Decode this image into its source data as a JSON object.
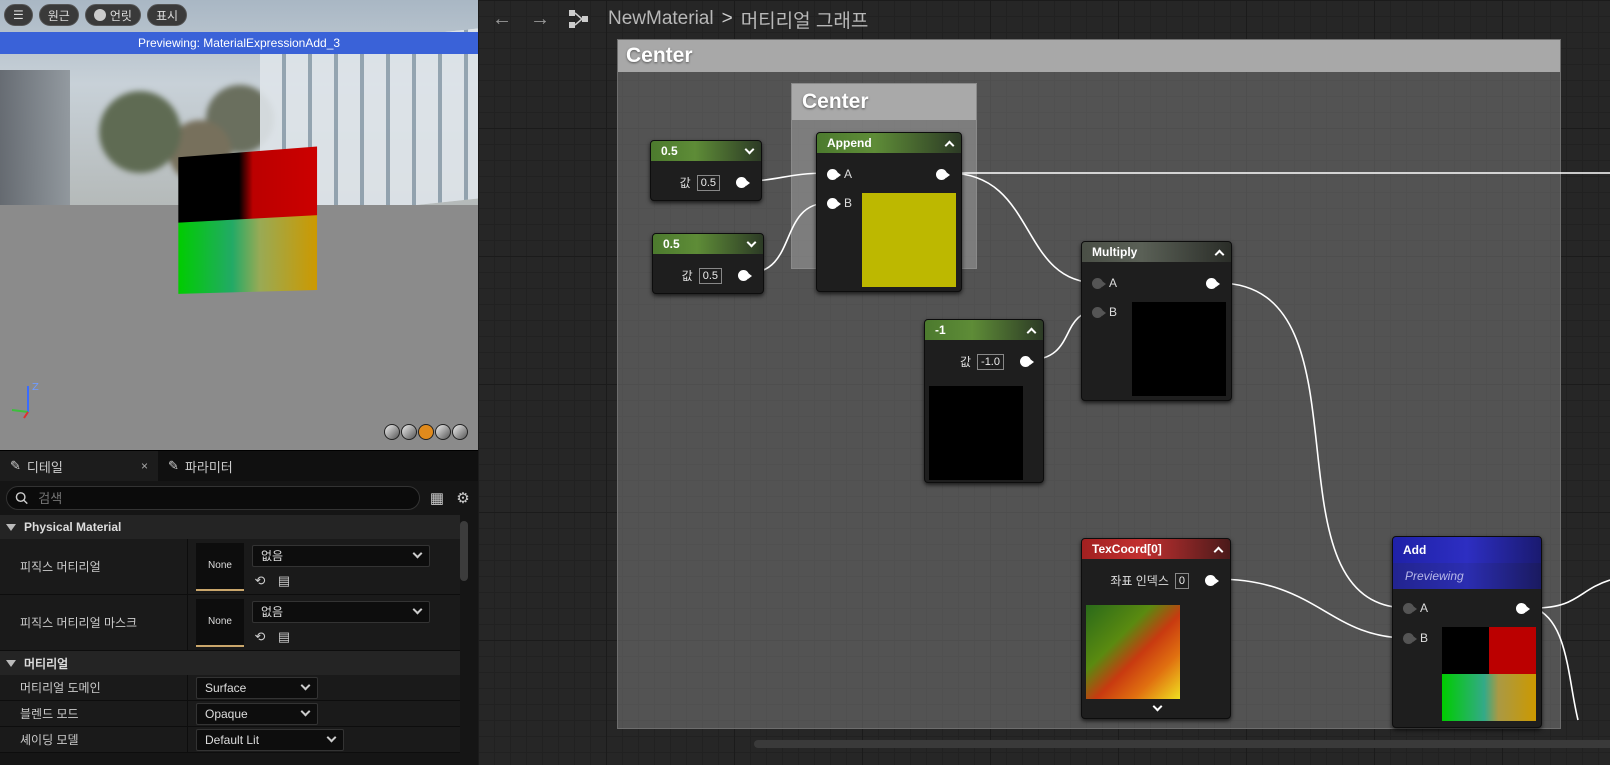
{
  "viewport": {
    "toolbar": {
      "menu_icon": "hamburger-icon",
      "perspective_label": "원근",
      "lit_label": "언릿",
      "show_label": "표시"
    },
    "preview_text": "Previewing: MaterialExpressionAdd_3",
    "axes": {
      "z_label": "Z"
    },
    "preview_shapes": [
      "cylinder",
      "sphere",
      "plane",
      "cube",
      "teapot"
    ],
    "active_shape_color": "#e08a1c"
  },
  "details": {
    "tabs": [
      {
        "label": "디테일",
        "icon": "pencil-icon",
        "active": true
      },
      {
        "label": "파라미터",
        "icon": "pencil-icon",
        "active": false
      }
    ],
    "tab_close": "×",
    "search": {
      "placeholder": "검색",
      "value": ""
    },
    "categories": [
      {
        "title": "Physical Material",
        "rows": [
          {
            "name": "피직스 머티리얼",
            "thumb": "None",
            "combo": "없음"
          },
          {
            "name": "피직스 머티리얼 마스크",
            "thumb": "None",
            "combo": "없음"
          }
        ]
      },
      {
        "title": "머티리얼",
        "rows": [
          {
            "name": "머티리얼 도메인",
            "combo": "Surface"
          },
          {
            "name": "블렌드 모드",
            "combo": "Opaque"
          },
          {
            "name": "셰이딩 모델",
            "combo": "Default Lit"
          }
        ]
      }
    ]
  },
  "graph": {
    "breadcrumb": {
      "asset": "NewMaterial",
      "separator": ">",
      "graph": "머티리얼 그래프"
    },
    "comments": {
      "outer_title": "Center",
      "inner_title": "Center"
    },
    "nodes": {
      "const1": {
        "title": "0.5",
        "pin_label": "값",
        "value": "0.5"
      },
      "const2": {
        "title": "0.5",
        "pin_label": "값",
        "value": "0.5"
      },
      "append": {
        "title": "Append",
        "pin_a": "A",
        "pin_b": "B",
        "swatch_color": "#bdb800"
      },
      "multiply": {
        "title": "Multiply",
        "pin_a": "A",
        "pin_b": "B",
        "swatch_color": "#000000"
      },
      "neg": {
        "title": "-1",
        "pin_label": "값",
        "value": "-1.0",
        "swatch_color": "#000000"
      },
      "texcoord": {
        "title": "TexCoord[0]",
        "pin_label": "좌표 인덱스",
        "value": "0"
      },
      "add": {
        "title": "Add",
        "subtitle": "Previewing",
        "pin_a": "A",
        "pin_b": "B"
      }
    }
  }
}
